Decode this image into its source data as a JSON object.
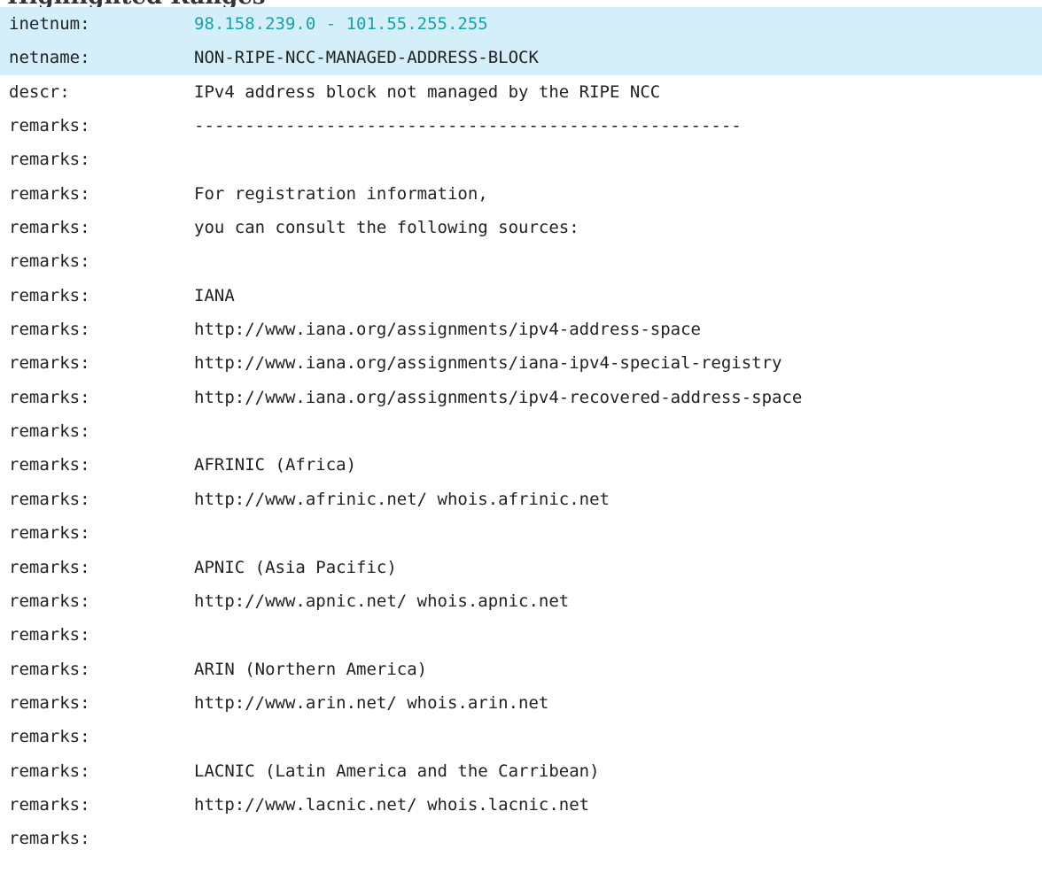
{
  "page": {
    "heading": "Highlighted Ranges"
  },
  "whois": {
    "rows": [
      {
        "key": "inetnum:",
        "value": "98.158.239.0 - 101.55.255.255",
        "highlight": true,
        "is_link": true
      },
      {
        "key": "netname:",
        "value": "NON-RIPE-NCC-MANAGED-ADDRESS-BLOCK",
        "highlight": true,
        "is_link": false
      },
      {
        "key": "descr:",
        "value": "IPv4 address block not managed by the RIPE NCC",
        "highlight": false,
        "is_link": false
      },
      {
        "key": "remarks:",
        "value": "------------------------------------------------------",
        "highlight": false,
        "is_link": false
      },
      {
        "key": "remarks:",
        "value": "",
        "highlight": false,
        "is_link": false
      },
      {
        "key": "remarks:",
        "value": "For registration information,",
        "highlight": false,
        "is_link": false
      },
      {
        "key": "remarks:",
        "value": "you can consult the following sources:",
        "highlight": false,
        "is_link": false
      },
      {
        "key": "remarks:",
        "value": "",
        "highlight": false,
        "is_link": false
      },
      {
        "key": "remarks:",
        "value": "IANA",
        "highlight": false,
        "is_link": false
      },
      {
        "key": "remarks:",
        "value": "http://www.iana.org/assignments/ipv4-address-space",
        "highlight": false,
        "is_link": false
      },
      {
        "key": "remarks:",
        "value": "http://www.iana.org/assignments/iana-ipv4-special-registry",
        "highlight": false,
        "is_link": false
      },
      {
        "key": "remarks:",
        "value": "http://www.iana.org/assignments/ipv4-recovered-address-space",
        "highlight": false,
        "is_link": false
      },
      {
        "key": "remarks:",
        "value": "",
        "highlight": false,
        "is_link": false
      },
      {
        "key": "remarks:",
        "value": "AFRINIC (Africa)",
        "highlight": false,
        "is_link": false
      },
      {
        "key": "remarks:",
        "value": "http://www.afrinic.net/ whois.afrinic.net",
        "highlight": false,
        "is_link": false
      },
      {
        "key": "remarks:",
        "value": "",
        "highlight": false,
        "is_link": false
      },
      {
        "key": "remarks:",
        "value": "APNIC (Asia Pacific)",
        "highlight": false,
        "is_link": false
      },
      {
        "key": "remarks:",
        "value": "http://www.apnic.net/ whois.apnic.net",
        "highlight": false,
        "is_link": false
      },
      {
        "key": "remarks:",
        "value": "",
        "highlight": false,
        "is_link": false
      },
      {
        "key": "remarks:",
        "value": "ARIN (Northern America)",
        "highlight": false,
        "is_link": false
      },
      {
        "key": "remarks:",
        "value": "http://www.arin.net/ whois.arin.net",
        "highlight": false,
        "is_link": false
      },
      {
        "key": "remarks:",
        "value": "",
        "highlight": false,
        "is_link": false
      },
      {
        "key": "remarks:",
        "value": "LACNIC (Latin America and the Carribean)",
        "highlight": false,
        "is_link": false
      },
      {
        "key": "remarks:",
        "value": "http://www.lacnic.net/ whois.lacnic.net",
        "highlight": false,
        "is_link": false
      },
      {
        "key": "remarks:",
        "value": "",
        "highlight": false,
        "is_link": false
      }
    ]
  },
  "colors": {
    "highlight_background": "#d4effa",
    "link_text": "#17a2a8",
    "body_text": "#222222"
  }
}
